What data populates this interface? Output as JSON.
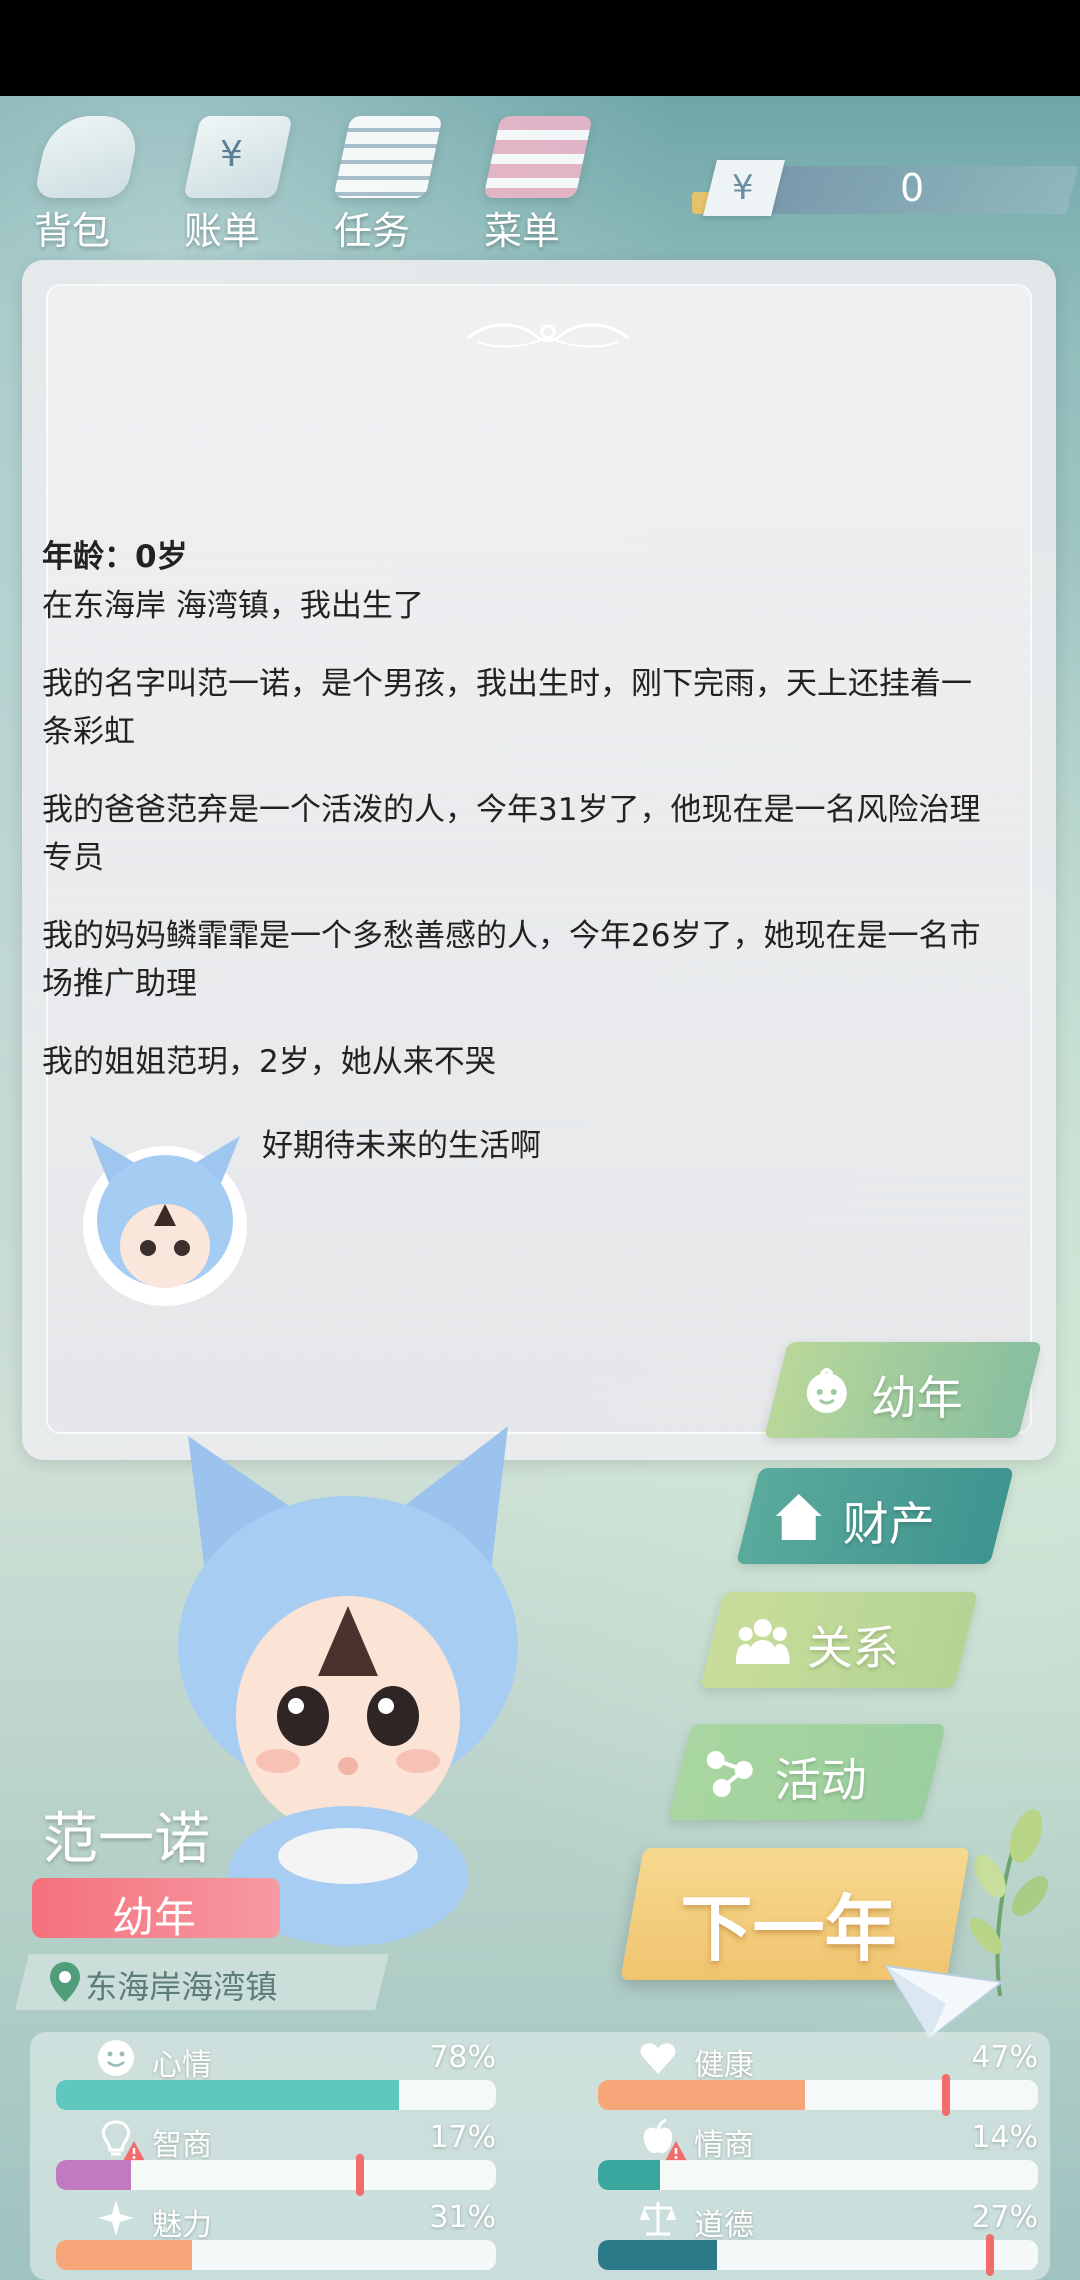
{
  "toolbar": {
    "items": [
      {
        "label": "背包",
        "icon": "bag-icon"
      },
      {
        "label": "账单",
        "icon": "bill-icon"
      },
      {
        "label": "任务",
        "icon": "task-icon"
      },
      {
        "label": "菜单",
        "icon": "menu-icon"
      }
    ],
    "currency_symbol": "¥",
    "money": "0"
  },
  "story": {
    "age_line": "年龄：0岁",
    "paragraphs": [
      "在东海岸 海湾镇，我出生了",
      "我的名字叫范一诺，是个男孩，我出生时，刚下完雨，天上还挂着一条彩虹",
      "我的爸爸范弃是一个活泼的人，今年31岁了，他现在是一名风险治理专员",
      "我的妈妈鳞霏霏是一个多愁善感的人，今年26岁了，她现在是一名市场推广助理",
      "我的姐姐范玥，2岁，她从来不哭"
    ],
    "closing": "好期待未来的生活啊"
  },
  "actions": {
    "stage": "幼年",
    "assets": "财产",
    "relations": "关系",
    "activities": "活动",
    "next_year": "下一年"
  },
  "character": {
    "name": "范一诺",
    "stage": "幼年",
    "location": "东海岸海湾镇"
  },
  "stats": [
    {
      "label": "心情",
      "value": "78%",
      "level": 0.78,
      "color": "#5ec7be",
      "icon": "smile-icon",
      "warning": false,
      "marker": null
    },
    {
      "label": "健康",
      "value": "47%",
      "level": 0.47,
      "color": "#f6a679",
      "icon": "heart-icon",
      "warning": false,
      "marker": 0.79
    },
    {
      "label": "智商",
      "value": "17%",
      "level": 0.17,
      "color": "#c07bc0",
      "icon": "bulb-icon",
      "warning": true,
      "marker": 0.69
    },
    {
      "label": "情商",
      "value": "14%",
      "level": 0.14,
      "color": "#3aa79e",
      "icon": "apple-icon",
      "warning": true,
      "marker": null
    },
    {
      "label": "魅力",
      "value": "31%",
      "level": 0.31,
      "color": "#f6a679",
      "icon": "sparkle-icon",
      "warning": false,
      "marker": null
    },
    {
      "label": "道德",
      "value": "27%",
      "level": 0.27,
      "color": "#2a7a8a",
      "icon": "scale-icon",
      "warning": false,
      "marker": 0.89
    }
  ],
  "colors": {
    "stage_badge": "#f4707c",
    "next_button": "#f0c46f",
    "warning": "#f26c6c"
  }
}
